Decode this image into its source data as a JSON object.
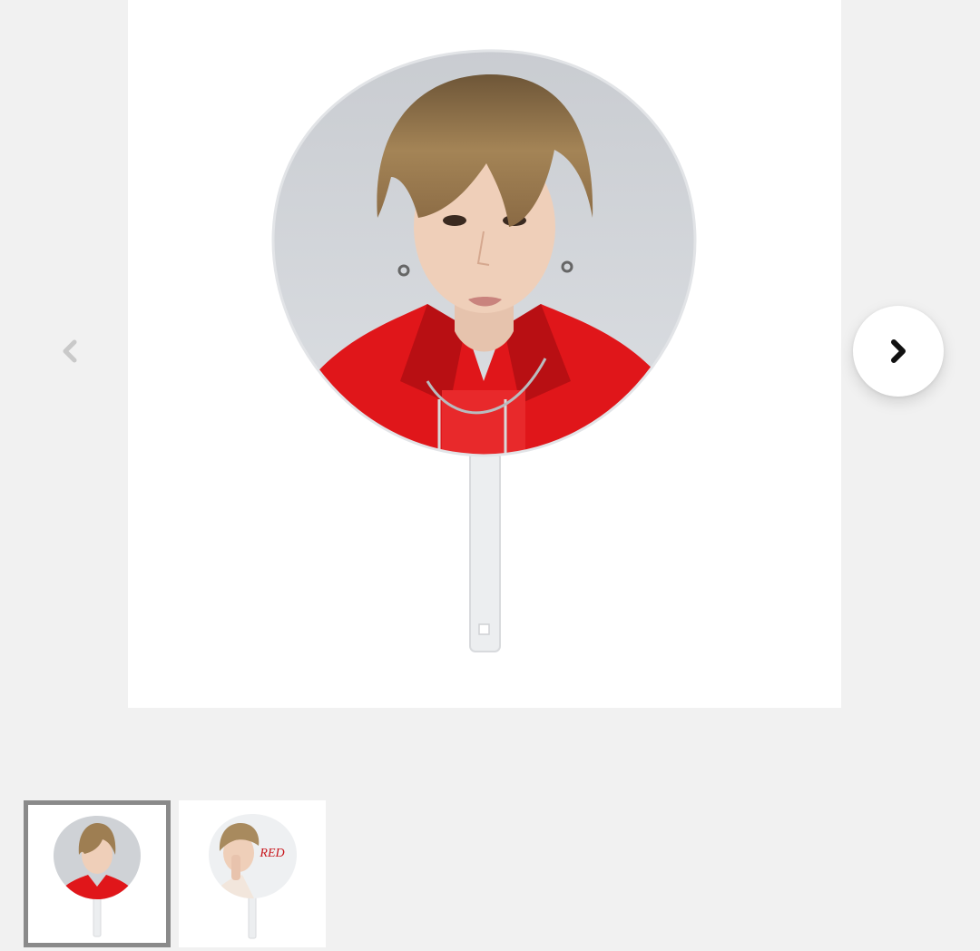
{
  "gallery": {
    "main_image_icon": "uchiwa-fan-photo-red-jacket",
    "prev_icon": "chevron-left-icon",
    "next_icon": "chevron-right-icon",
    "thumbnails": [
      {
        "icon": "uchiwa-thumbnail-red-jacket",
        "active": true
      },
      {
        "icon": "uchiwa-thumbnail-red-logo",
        "active": false,
        "logo_text": "RED"
      }
    ]
  },
  "colors": {
    "page_background": "#f1f1f1",
    "frame_background": "#ffffff",
    "active_thumb_border": "#8a8a8a",
    "jacket_red": "#e0161a",
    "prev_arrow": "#c9c9c9",
    "next_arrow": "#111111"
  }
}
